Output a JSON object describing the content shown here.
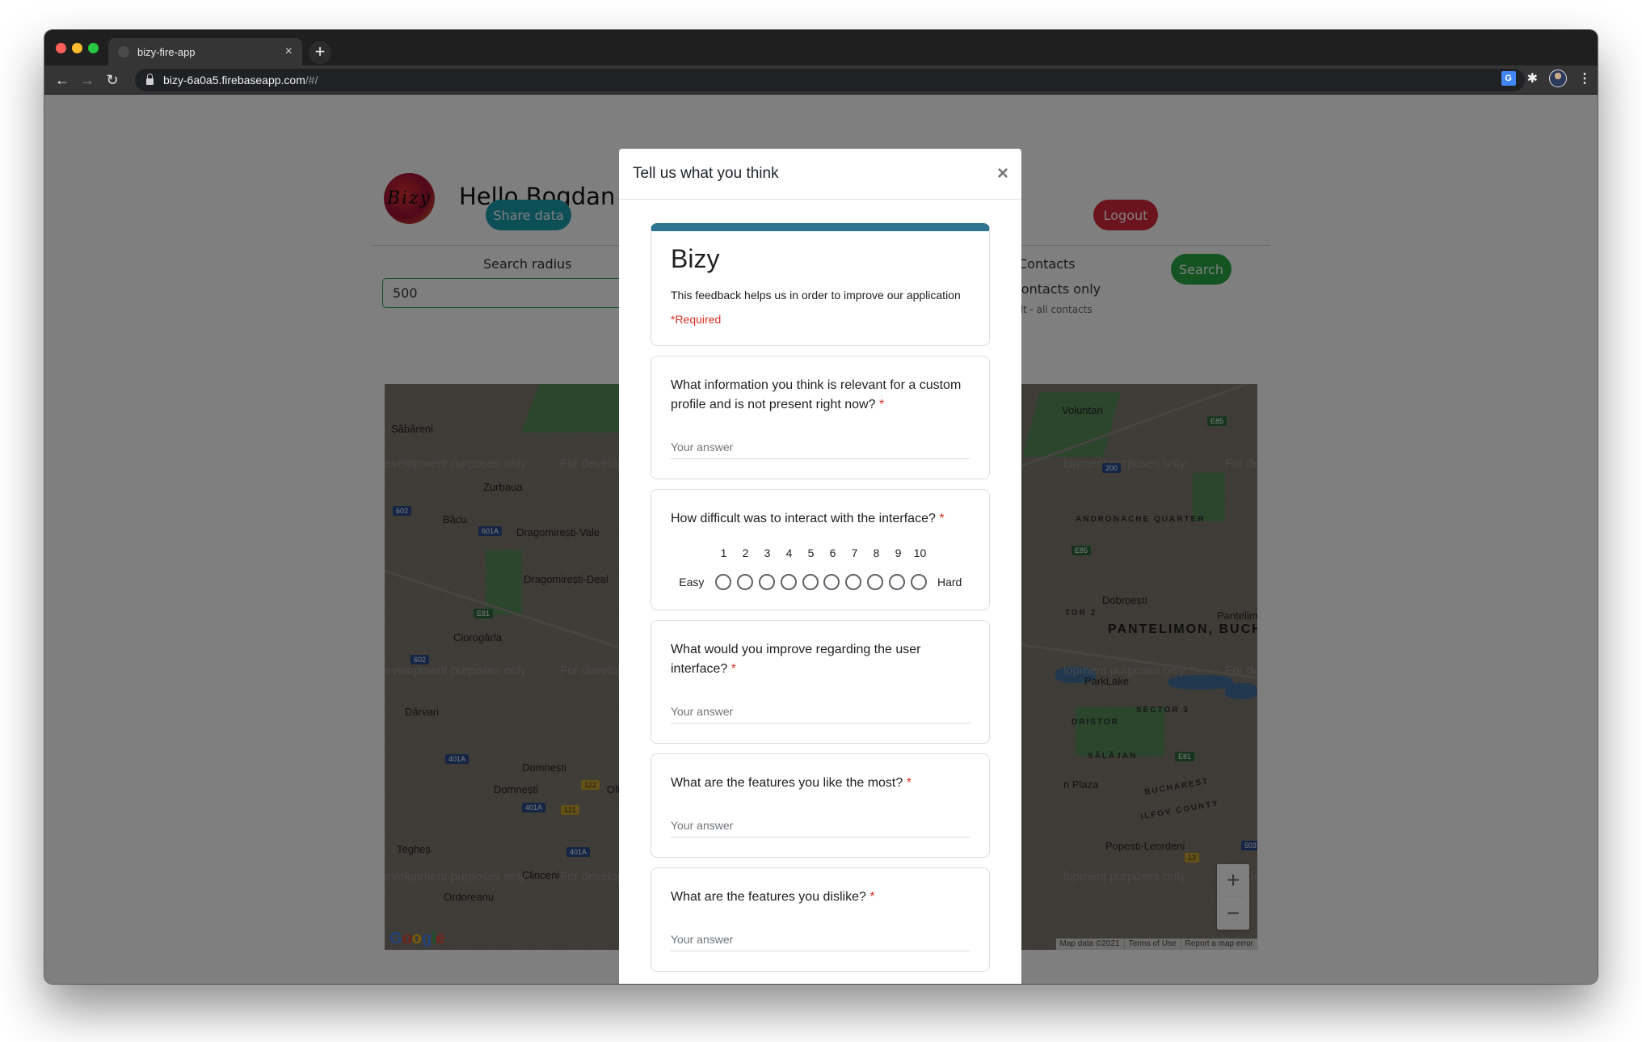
{
  "browser": {
    "tab_title": "bizy-fire-app",
    "tab_close": "×",
    "new_tab": "+",
    "url_host": "bizy-6a0a5.firebaseapp.com",
    "url_path": "/#/",
    "icons": {
      "back": "←",
      "forward": "→",
      "reload": "↻",
      "bookmark": "☆",
      "translate": "G",
      "extensions": "✱",
      "menu": "⋮"
    }
  },
  "app": {
    "logo_text": "Bizy",
    "greeting": "Hello Bogdan F",
    "share_button": "Share data",
    "logout_button": "Logout",
    "search_radius_label": "Search radius",
    "search_radius_value": "500",
    "contacts_label": "Contacts",
    "contacts_option": "contacts only",
    "contacts_hint": "ult - all contacts",
    "search_button": "Search",
    "colors": {
      "share": "#1a9fae",
      "logout": "#d9283a",
      "search": "#28a745"
    }
  },
  "map": {
    "watermark": "For development purposes only",
    "watermark_left": "evelopment purposes only",
    "watermark_right": "For develop",
    "watermark_mid": "lopment purposes only",
    "places": [
      "Săbăreni",
      "Zurbaua",
      "Bâcu",
      "Dragomirești-Vale",
      "Dragomirești-Deal",
      "Ciorogârla",
      "Dârvari",
      "Domnești",
      "Domnești",
      "Tegheș",
      "Clinceni",
      "Ordoreanu",
      "Voluntari",
      "Dobroești",
      "Pantelimon",
      "Popesti-Leordeni",
      "n Plaza",
      "ParkLake",
      "Olt"
    ],
    "districts": [
      "ANDRONACHE QUARTER",
      "SECTOR 3",
      "DRISTOR",
      "SĂLĂJAN",
      "BUCHAREST",
      "ILFOV COUNTY",
      "TOR 2"
    ],
    "big_label": "PANTELIMON, BUCHAREST",
    "shields": [
      "602",
      "601A",
      "E81",
      "602",
      "401A",
      "401A",
      "401A",
      "122",
      "121",
      "200",
      "E85",
      "E85",
      "E81",
      "13",
      "503"
    ],
    "google": [
      "G",
      "o",
      "o",
      "g",
      "l",
      "e"
    ],
    "zoom_in": "+",
    "zoom_out": "−",
    "footer": [
      "Map data ©2021",
      "Terms of Use",
      "Report a map error"
    ]
  },
  "modal": {
    "title": "Tell us what you think",
    "close": "×",
    "form": {
      "title": "Bizy",
      "description": "This feedback helps us in order to improve our application",
      "required_note": "*Required",
      "accent_color": "#2e7591",
      "questions": [
        {
          "title": "What information you think is relevant for a custom profile and is not present right now?",
          "required": "*",
          "placeholder": "Your answer"
        },
        {
          "title": "How difficult was to interact with the interface?",
          "required": "*",
          "scale_min_label": "Easy",
          "scale_max_label": "Hard",
          "scale": [
            "1",
            "2",
            "3",
            "4",
            "5",
            "6",
            "7",
            "8",
            "9",
            "10"
          ]
        },
        {
          "title": "What would you improve regarding the user interface?",
          "required": "*",
          "placeholder": "Your answer"
        },
        {
          "title": "What are the features you like the most?",
          "required": "*",
          "placeholder": "Your answer"
        },
        {
          "title": "What are the features you dislike?",
          "required": "*",
          "placeholder": "Your answer"
        }
      ]
    }
  }
}
